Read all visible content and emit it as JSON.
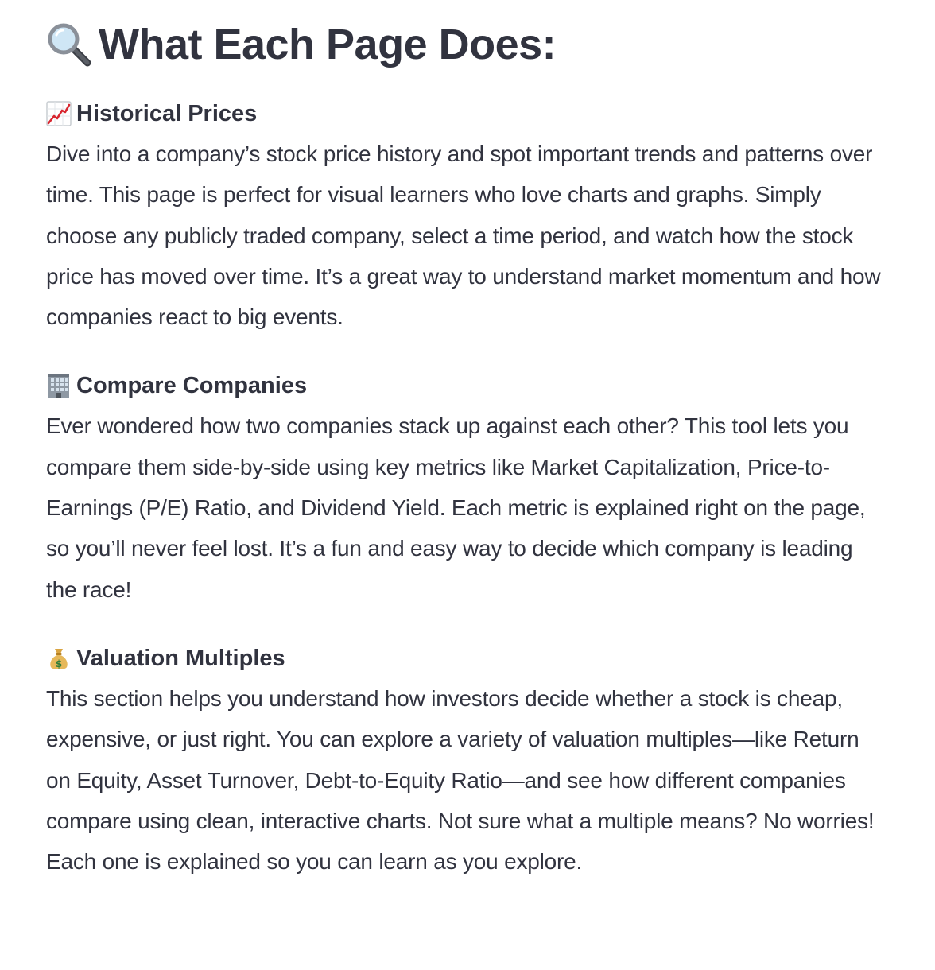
{
  "page": {
    "title": "What Each Page Does:",
    "title_icon": "magnifying-glass-icon"
  },
  "sections": [
    {
      "icon": "chart-increasing-icon",
      "heading": "Historical Prices",
      "body": "Dive into a company’s stock price history and spot important trends and patterns over time. This page is perfect for visual learners who love charts and graphs. Simply choose any publicly traded company, select a time period, and watch how the stock price has moved over time. It’s a great way to understand market momentum and how companies react to big events."
    },
    {
      "icon": "office-building-icon",
      "heading": "Compare Companies",
      "body": "Ever wondered how two companies stack up against each other? This tool lets you compare them side-by-side using key metrics like Market Capitalization, Price-to-Earnings (P/E) Ratio, and Dividend Yield. Each metric is explained right on the page, so you’ll never feel lost. It’s a fun and easy way to decide which company is leading the race!"
    },
    {
      "icon": "money-bag-icon",
      "heading": "Valuation Multiples",
      "body": "This section helps you understand how investors decide whether a stock is cheap, expensive, or just right. You can explore a variety of valuation multiples—like Return on Equity, Asset Turnover, Debt-to-Equity Ratio—and see how different companies compare using clean, interactive charts. Not sure what a multiple means? No worries! Each one is explained so you can learn as you explore."
    }
  ],
  "colors": {
    "text": "#31333f",
    "background": "#ffffff"
  }
}
